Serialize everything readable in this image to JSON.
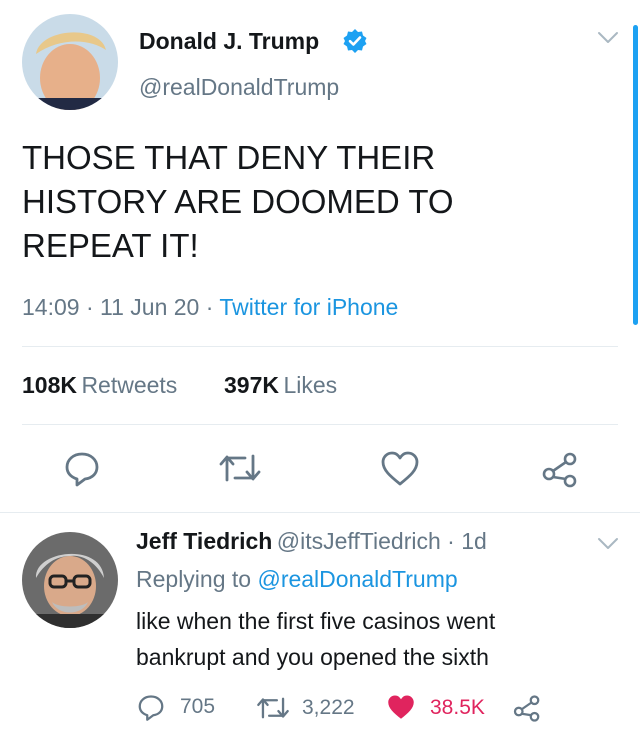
{
  "tweet": {
    "name": "Donald J. Trump",
    "handle": "@realDonaldTrump",
    "text_lines": [
      "THOSE THAT DENY THEIR",
      "HISTORY ARE DOOMED TO",
      "REPEAT IT!"
    ],
    "time": "14:09",
    "date": "11 Jun 20",
    "source": "Twitter for iPhone",
    "retweets_count": "108K",
    "retweets_label": "Retweets",
    "likes_count": "397K",
    "likes_label": "Likes",
    "icons": [
      "reply-icon",
      "retweet-icon",
      "like-icon",
      "share-icon"
    ]
  },
  "reply": {
    "name": "Jeff Tiedrich",
    "handle": "@itsJeffTiedrich",
    "age": "1d",
    "replying_prefix": "Replying to",
    "replying_to": "@realDonaldTrump",
    "text_lines": [
      "like when the first five casinos went",
      "bankrupt and you opened the sixth"
    ],
    "reply_count": "705",
    "retweet_count": "3,222",
    "like_count": "38.5K",
    "liked": true
  },
  "colors": {
    "verified": "#1da1f2",
    "link": "#1b95e0",
    "like": "#e0245e",
    "muted": "#657786"
  }
}
